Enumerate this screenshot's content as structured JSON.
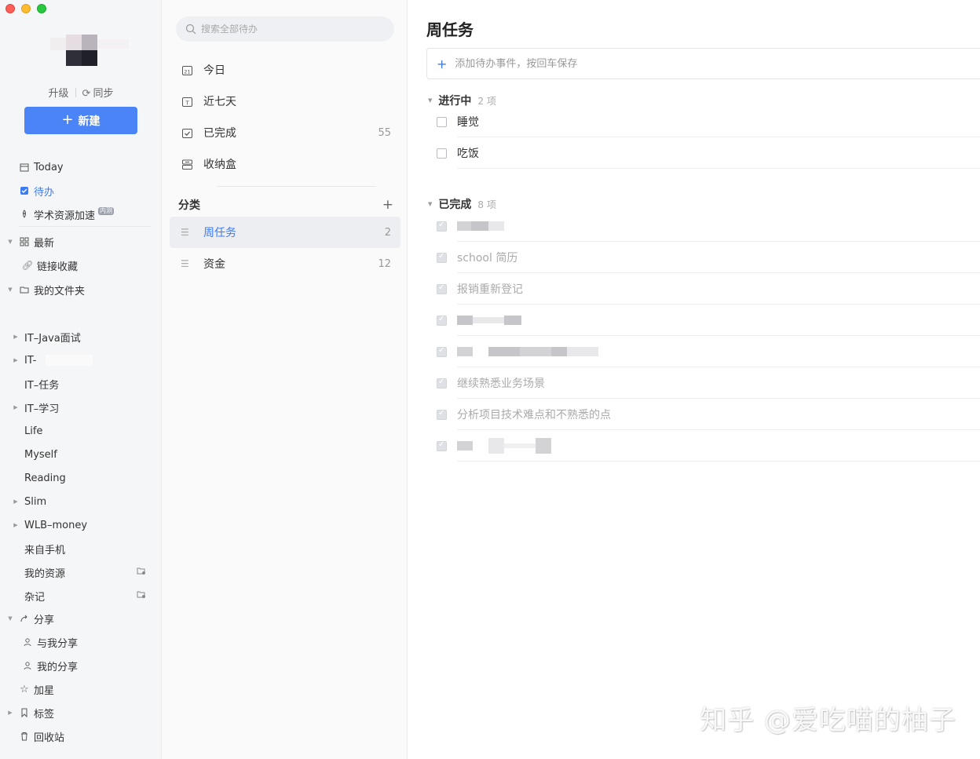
{
  "sidebar": {
    "account": {
      "upgrade": "升级",
      "sync": "同步"
    },
    "new_button": "新建",
    "items": [
      {
        "label": "Today",
        "icon": "calendar-icon"
      },
      {
        "label": "待办",
        "icon": "checkbox-icon",
        "active": true
      },
      {
        "label": "学术资源加速",
        "icon": "rocket-icon",
        "badge": "内测"
      },
      {
        "label": "最新",
        "icon": "grid-icon",
        "expandable": true
      },
      {
        "label": "链接收藏",
        "icon": "link-icon"
      },
      {
        "label": "我的文件夹",
        "icon": "folder-icon",
        "expandable": true
      },
      {
        "label": "IT–Java面试"
      },
      {
        "label": "IT-"
      },
      {
        "label": "IT–任务"
      },
      {
        "label": "IT–学习"
      },
      {
        "label": "Life"
      },
      {
        "label": "Myself"
      },
      {
        "label": "Reading"
      },
      {
        "label": "Slim"
      },
      {
        "label": "WLB–money"
      },
      {
        "label": "来自手机"
      },
      {
        "label": "我的资源"
      },
      {
        "label": "杂记"
      },
      {
        "label": "分享",
        "icon": "share-icon"
      },
      {
        "label": "与我分享",
        "icon": "user-icon"
      },
      {
        "label": "我的分享",
        "icon": "user-icon"
      },
      {
        "label": "加星",
        "icon": "star-icon"
      },
      {
        "label": "标签",
        "icon": "bookmark-icon"
      },
      {
        "label": "回收站",
        "icon": "trash-icon"
      }
    ]
  },
  "middle": {
    "search_placeholder": "搜索全部待办",
    "filters": [
      {
        "label": "今日",
        "icon": "calendar-21-icon",
        "count": ""
      },
      {
        "label": "近七天",
        "icon": "calendar-t-icon",
        "count": ""
      },
      {
        "label": "已完成",
        "icon": "calendar-check-icon",
        "count": "55"
      },
      {
        "label": "收纳盒",
        "icon": "inbox-icon",
        "count": ""
      }
    ],
    "categories_title": "分类",
    "categories": [
      {
        "label": "周任务",
        "count": "2",
        "selected": true
      },
      {
        "label": "资金",
        "count": "12"
      }
    ]
  },
  "main": {
    "title": "周任务",
    "add_placeholder": "添加待办事件，按回车保存",
    "in_progress": {
      "label": "进行中",
      "count": "2 项",
      "tasks": [
        "睡觉",
        "吃饭"
      ]
    },
    "completed": {
      "label": "已完成",
      "count": "8 项",
      "tasks": [
        "",
        "school 简历",
        "报销重新登记",
        "",
        "",
        "继续熟悉业务场景",
        "分析项目技术难点和不熟悉的点",
        ""
      ]
    }
  },
  "watermark": "知乎 @爱吃喵的柚子",
  "colors": {
    "accent": "#4a84f6",
    "active_text": "#3b7bf3"
  }
}
